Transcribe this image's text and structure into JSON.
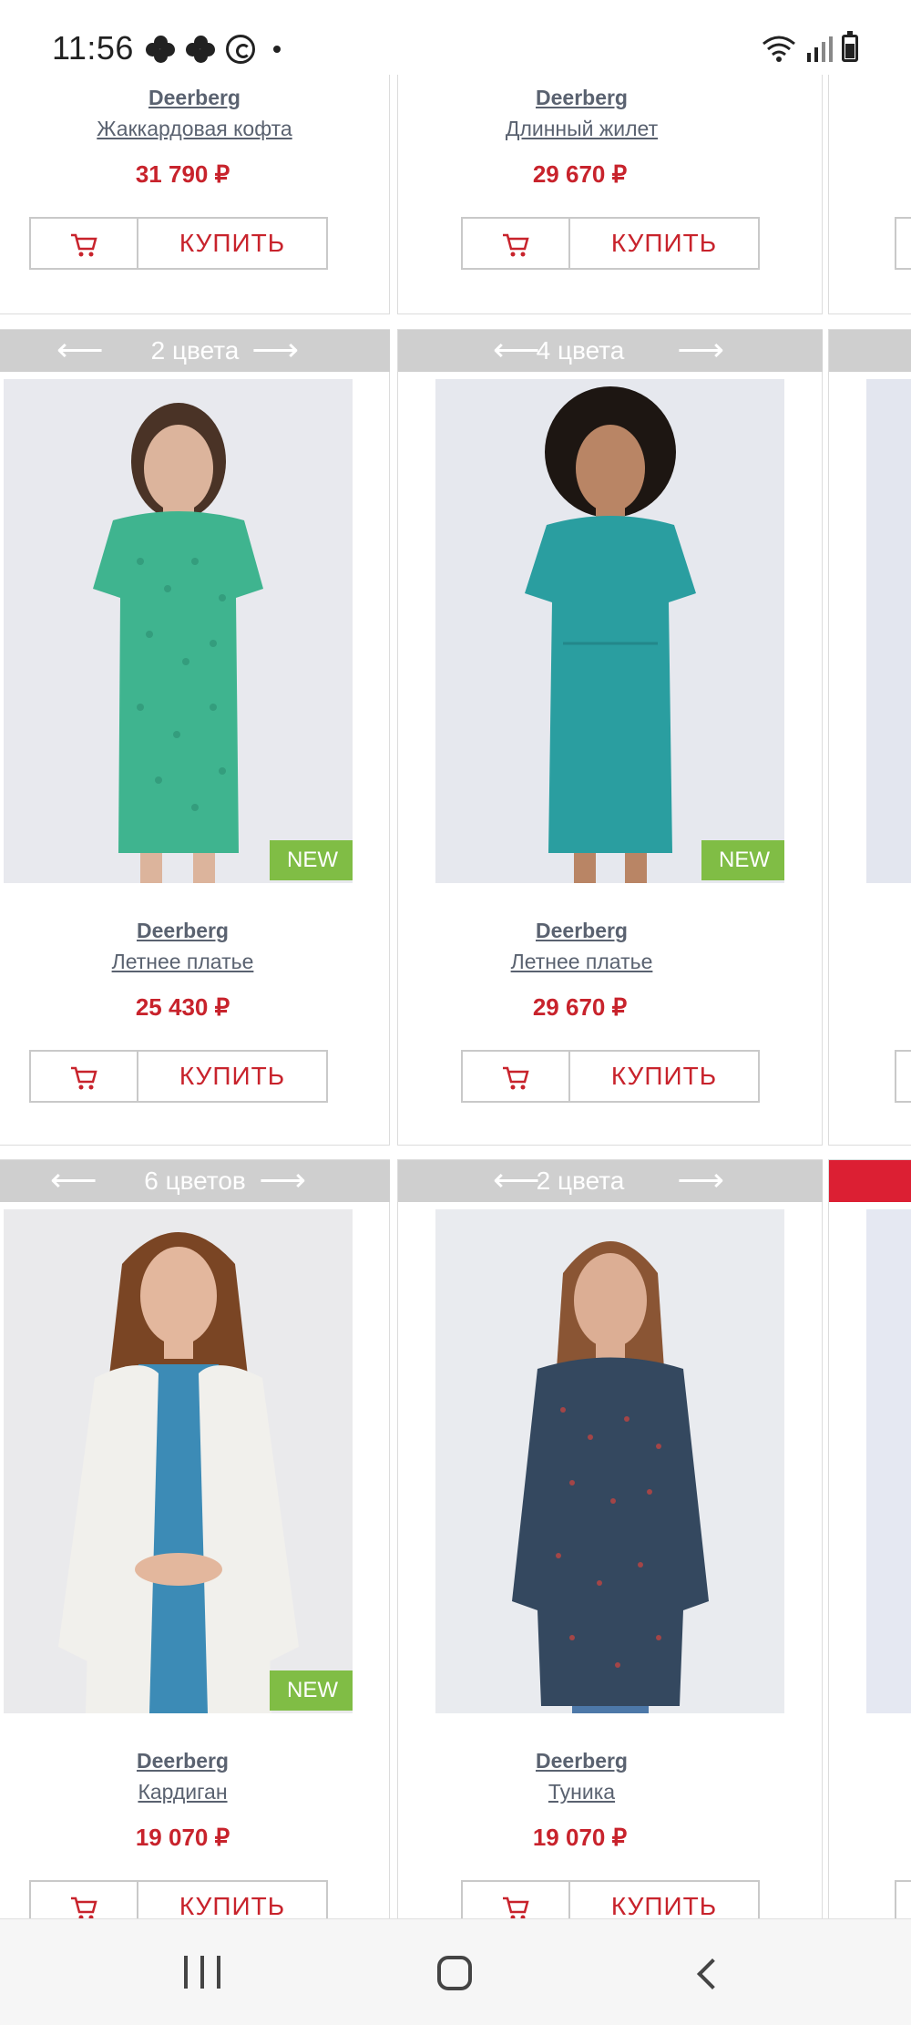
{
  "status_bar": {
    "time": "11:56",
    "icons": [
      "notification-cluster-icon",
      "notification-cluster-icon",
      "whatsapp-icon",
      "dot-icon",
      "wifi-icon",
      "signal-icon",
      "battery-icon"
    ]
  },
  "buy_label": "КУПИТЬ",
  "new_label": "NEW",
  "colors": {
    "price": "#c8232c",
    "new_badge": "#80bd45",
    "color_bar": "#cfcfcf",
    "text": "#5a6270",
    "accent_red": "#dc1f33"
  },
  "products": [
    {
      "brand": "Deerberg",
      "name": "Жаккардовая кофта",
      "price": "31 790 ₽"
    },
    {
      "brand": "Deerberg",
      "name": "Длинный жилет",
      "price": "29 670 ₽"
    },
    {
      "colors": "2 цвета",
      "brand": "Deerberg",
      "name": "Летнее платье",
      "price": "25 430 ₽",
      "new": true
    },
    {
      "colors": "4 цвета",
      "brand": "Deerberg",
      "name": "Летнее платье",
      "price": "29 670 ₽",
      "new": true
    },
    {
      "colors": "6 цветов",
      "brand": "Deerberg",
      "name": "Кардиган",
      "price": "19 070 ₽",
      "new": true
    },
    {
      "colors": "2 цвета",
      "brand": "Deerberg",
      "name": "Туника",
      "price": "19 070 ₽",
      "new": false
    }
  ]
}
